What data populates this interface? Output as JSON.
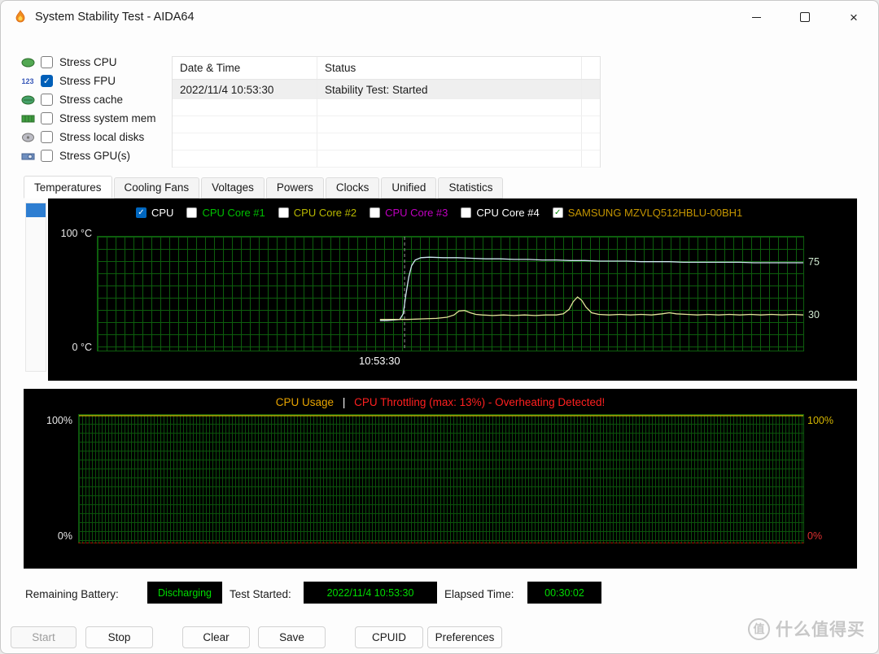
{
  "window": {
    "title": "System Stability Test - AIDA64"
  },
  "colors": {
    "accent_blue": "#005fb8",
    "grid_green": "#0d5e0d",
    "status_green": "#00dd00",
    "alert_red": "#ff2020",
    "usage_orange": "#e8a400"
  },
  "stress_options": [
    {
      "label": "Stress CPU",
      "checked": false,
      "icon": "cpu-icon"
    },
    {
      "label": "Stress FPU",
      "checked": true,
      "icon": "fpu-icon",
      "icon_text": "123"
    },
    {
      "label": "Stress cache",
      "checked": false,
      "icon": "cache-icon"
    },
    {
      "label": "Stress system mem",
      "checked": false,
      "icon": "memory-icon"
    },
    {
      "label": "Stress local disks",
      "checked": false,
      "icon": "disk-icon"
    },
    {
      "label": "Stress GPU(s)",
      "checked": false,
      "icon": "gpu-icon"
    }
  ],
  "log_table": {
    "columns": [
      "Date & Time",
      "Status"
    ],
    "rows": [
      {
        "datetime": "2022/11/4 10:53:30",
        "status": "Stability Test: Started"
      }
    ]
  },
  "tabs": [
    {
      "label": "Temperatures",
      "active": true
    },
    {
      "label": "Cooling Fans",
      "active": false
    },
    {
      "label": "Voltages",
      "active": false
    },
    {
      "label": "Powers",
      "active": false
    },
    {
      "label": "Clocks",
      "active": false
    },
    {
      "label": "Unified",
      "active": false
    },
    {
      "label": "Statistics",
      "active": false
    }
  ],
  "temperature_chart": {
    "legend": [
      {
        "label": "CPU",
        "checked": true,
        "color": "#ffffff"
      },
      {
        "label": "CPU Core #1",
        "checked": false,
        "color": "#00c000"
      },
      {
        "label": "CPU Core #2",
        "checked": false,
        "color": "#b8b800"
      },
      {
        "label": "CPU Core #3",
        "checked": false,
        "color": "#c000c0"
      },
      {
        "label": "CPU Core #4",
        "checked": false,
        "color": "#ffffff"
      },
      {
        "label": "SAMSUNG MZVLQ512HBLU-00BH1",
        "checked": true,
        "color": "#c49500"
      }
    ],
    "y_max_label": "100 °C",
    "y_min_label": "0 °C",
    "right_labels": [
      "75",
      "30"
    ],
    "x_label": "10:53:30"
  },
  "usage_chart": {
    "title_left": "CPU Usage",
    "title_sep": "|",
    "title_right": "CPU Throttling (max: 13%) - Overheating Detected!",
    "left_top": "100%",
    "left_bottom": "0%",
    "right_top": "100%",
    "right_bottom": "0%"
  },
  "chart_data": [
    {
      "type": "line",
      "title": "Temperatures",
      "ylabel": "°C",
      "ylim": [
        0,
        100
      ],
      "event_marker_x": 0.435,
      "series": [
        {
          "name": "CPU",
          "color": "#cfe8f0",
          "points": [
            [
              0.4,
              26
            ],
            [
              0.41,
              26
            ],
            [
              0.42,
              26.5
            ],
            [
              0.428,
              27
            ],
            [
              0.433,
              32
            ],
            [
              0.437,
              50
            ],
            [
              0.441,
              65
            ],
            [
              0.445,
              75
            ],
            [
              0.45,
              80
            ],
            [
              0.458,
              82
            ],
            [
              0.47,
              82.5
            ],
            [
              0.49,
              82
            ],
            [
              0.51,
              82
            ],
            [
              0.53,
              81.5
            ],
            [
              0.55,
              81
            ],
            [
              0.57,
              81
            ],
            [
              0.59,
              80.5
            ],
            [
              0.61,
              80.5
            ],
            [
              0.63,
              80
            ],
            [
              0.65,
              80
            ],
            [
              0.67,
              79.5
            ],
            [
              0.69,
              79.5
            ],
            [
              0.71,
              79
            ],
            [
              0.73,
              79
            ],
            [
              0.75,
              79
            ],
            [
              0.77,
              78.5
            ],
            [
              0.79,
              78.5
            ],
            [
              0.81,
              78.5
            ],
            [
              0.83,
              78
            ],
            [
              0.85,
              78
            ],
            [
              0.87,
              78
            ],
            [
              0.89,
              78
            ],
            [
              0.91,
              78
            ],
            [
              0.93,
              77.5
            ],
            [
              0.95,
              77.5
            ],
            [
              0.97,
              77.5
            ],
            [
              1.0,
              77.5
            ]
          ]
        },
        {
          "name": "SAMSUNG MZVLQ512HBLU-00BH1",
          "color": "#e3e39a",
          "points": [
            [
              0.4,
              27
            ],
            [
              0.42,
              27
            ],
            [
              0.44,
              27
            ],
            [
              0.46,
              27.5
            ],
            [
              0.48,
              28
            ],
            [
              0.495,
              29
            ],
            [
              0.505,
              31
            ],
            [
              0.512,
              34.5
            ],
            [
              0.52,
              35
            ],
            [
              0.528,
              33
            ],
            [
              0.536,
              31.5
            ],
            [
              0.545,
              31
            ],
            [
              0.56,
              30.5
            ],
            [
              0.575,
              31
            ],
            [
              0.59,
              30.5
            ],
            [
              0.605,
              31
            ],
            [
              0.62,
              30.5
            ],
            [
              0.635,
              31
            ],
            [
              0.65,
              31
            ],
            [
              0.66,
              32
            ],
            [
              0.668,
              36
            ],
            [
              0.674,
              43
            ],
            [
              0.68,
              47
            ],
            [
              0.686,
              44
            ],
            [
              0.692,
              38
            ],
            [
              0.7,
              33
            ],
            [
              0.71,
              31.5
            ],
            [
              0.725,
              31
            ],
            [
              0.74,
              31.5
            ],
            [
              0.755,
              31
            ],
            [
              0.77,
              31.5
            ],
            [
              0.785,
              31
            ],
            [
              0.8,
              32
            ],
            [
              0.81,
              33
            ],
            [
              0.82,
              32
            ],
            [
              0.835,
              31.5
            ],
            [
              0.85,
              31
            ],
            [
              0.865,
              31.5
            ],
            [
              0.88,
              31
            ],
            [
              0.895,
              31.5
            ],
            [
              0.91,
              31
            ],
            [
              0.925,
              31.5
            ],
            [
              0.94,
              31
            ],
            [
              0.955,
              31.5
            ],
            [
              0.97,
              31
            ],
            [
              0.985,
              31.5
            ],
            [
              1.0,
              31
            ]
          ]
        }
      ]
    },
    {
      "type": "line",
      "title": "CPU Usage",
      "ylabel": "%",
      "ylim": [
        0,
        100
      ],
      "series": [
        {
          "name": "CPU Usage",
          "color": "#d8c000",
          "points": [
            [
              0,
              100
            ],
            [
              1,
              100
            ]
          ]
        }
      ]
    }
  ],
  "status_bar": {
    "battery_label": "Remaining Battery:",
    "battery_value": "Discharging",
    "started_label": "Test Started:",
    "started_value": "2022/11/4 10:53:30",
    "elapsed_label": "Elapsed Time:",
    "elapsed_value": "00:30:02"
  },
  "action_buttons": [
    {
      "label": "Start",
      "enabled": false
    },
    {
      "label": "Stop",
      "enabled": true
    },
    {
      "label": "Clear",
      "enabled": true
    },
    {
      "label": "Save",
      "enabled": true
    },
    {
      "label": "CPUID",
      "enabled": true
    },
    {
      "label": "Preferences",
      "enabled": true
    }
  ],
  "watermark": {
    "circle_text": "值",
    "text": "什么值得买"
  }
}
